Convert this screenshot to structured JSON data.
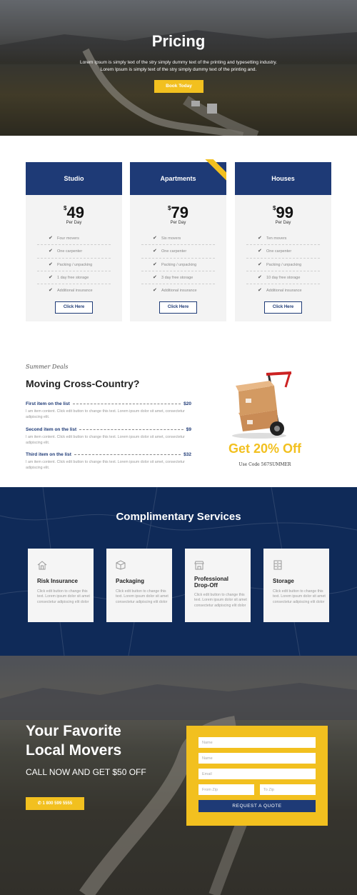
{
  "hero": {
    "title": "Pricing",
    "text_line1": "Lorem Ipsum is simply text of the stry simply dummy text of the printing and typesetting industry.",
    "text_line2": "Lorem Ipsum is simply text of the stry simply dummy text of the printing and.",
    "button": "Book Today"
  },
  "pricing": {
    "currency": "$",
    "per_label": "Per Day",
    "button": "Click Here",
    "plans": [
      {
        "name": "Studio",
        "price": "49",
        "features": [
          "Four movers",
          "One carpenter",
          "Packing / unpacking",
          "1 day free storage",
          "Additional insurance"
        ]
      },
      {
        "name": "Apartments",
        "price": "79",
        "features": [
          "Six movers",
          "One carpenter",
          "Packing / unpacking",
          "3 day free storage",
          "Additional insurance"
        ]
      },
      {
        "name": "Houses",
        "price": "99",
        "features": [
          "Ten movers",
          "One carpenter",
          "Packing / unpacking",
          "10 day free storage",
          "Additional insurance"
        ]
      }
    ]
  },
  "deals": {
    "kicker": "Summer Deals",
    "title": "Moving Cross-Country?",
    "items": [
      {
        "name": "First item on the list",
        "price": "$20",
        "desc": "I am item content. Click edit button to change this text. Lorem ipsum dolor sit amet, consectetur adipiscing elit."
      },
      {
        "name": "Second item on the list",
        "price": "$9",
        "desc": "I am item content. Click edit button to change this text. Lorem ipsum dolor sit amet, consectetur adipiscing elit."
      },
      {
        "name": "Third item on the list",
        "price": "$32",
        "desc": "I am item content. Click edit button to change this text. Lorem ipsum dolor sit amet, consectetur adipiscing elit."
      }
    ],
    "promo_title": "Get 20% Off",
    "promo_code": "Use Code 567SUMMER"
  },
  "services": {
    "title": "Complimentary Services",
    "items": [
      {
        "name": "Risk Insurance",
        "icon": "house-icon",
        "desc": "Click edit button to change this text. Lorem ipsum dolor sit amet consectetur adipiscing elit dolor"
      },
      {
        "name": "Packaging",
        "icon": "box-icon",
        "desc": "Click edit button to change this text. Lorem ipsum dolor sit amet consectetur adipiscing elit dolor"
      },
      {
        "name": "Professional Drop-Off",
        "name_line1": "Professional",
        "name_line2": "Drop-Off",
        "icon": "store-icon",
        "desc": "Click edit button to change this text. Lorem ipsum dolor sit amet consectetur adipiscing elit dolor"
      },
      {
        "name": "Storage",
        "icon": "storage-icon",
        "desc": "Click edit button to change this text. Lorem ipsum dolor sit amet consectetur adipiscing elit dolor"
      }
    ]
  },
  "cta": {
    "heading_line1": "Your Favorite",
    "heading_line2": "Local Movers",
    "subheading": "CALL NOW AND GET $50 OFF",
    "phone": "1 800 599 5555",
    "phone_icon": "phone-icon",
    "form": {
      "name1_placeholder": "Name",
      "name2_placeholder": "Name",
      "email_placeholder": "Email",
      "from_placeholder": "From Zip",
      "to_placeholder": "To Zip",
      "submit": "REQUEST A QUOTE"
    }
  },
  "colors": {
    "navy": "#1e3a76",
    "yellow": "#f2c01f",
    "dark_navy": "#0f2a58"
  }
}
